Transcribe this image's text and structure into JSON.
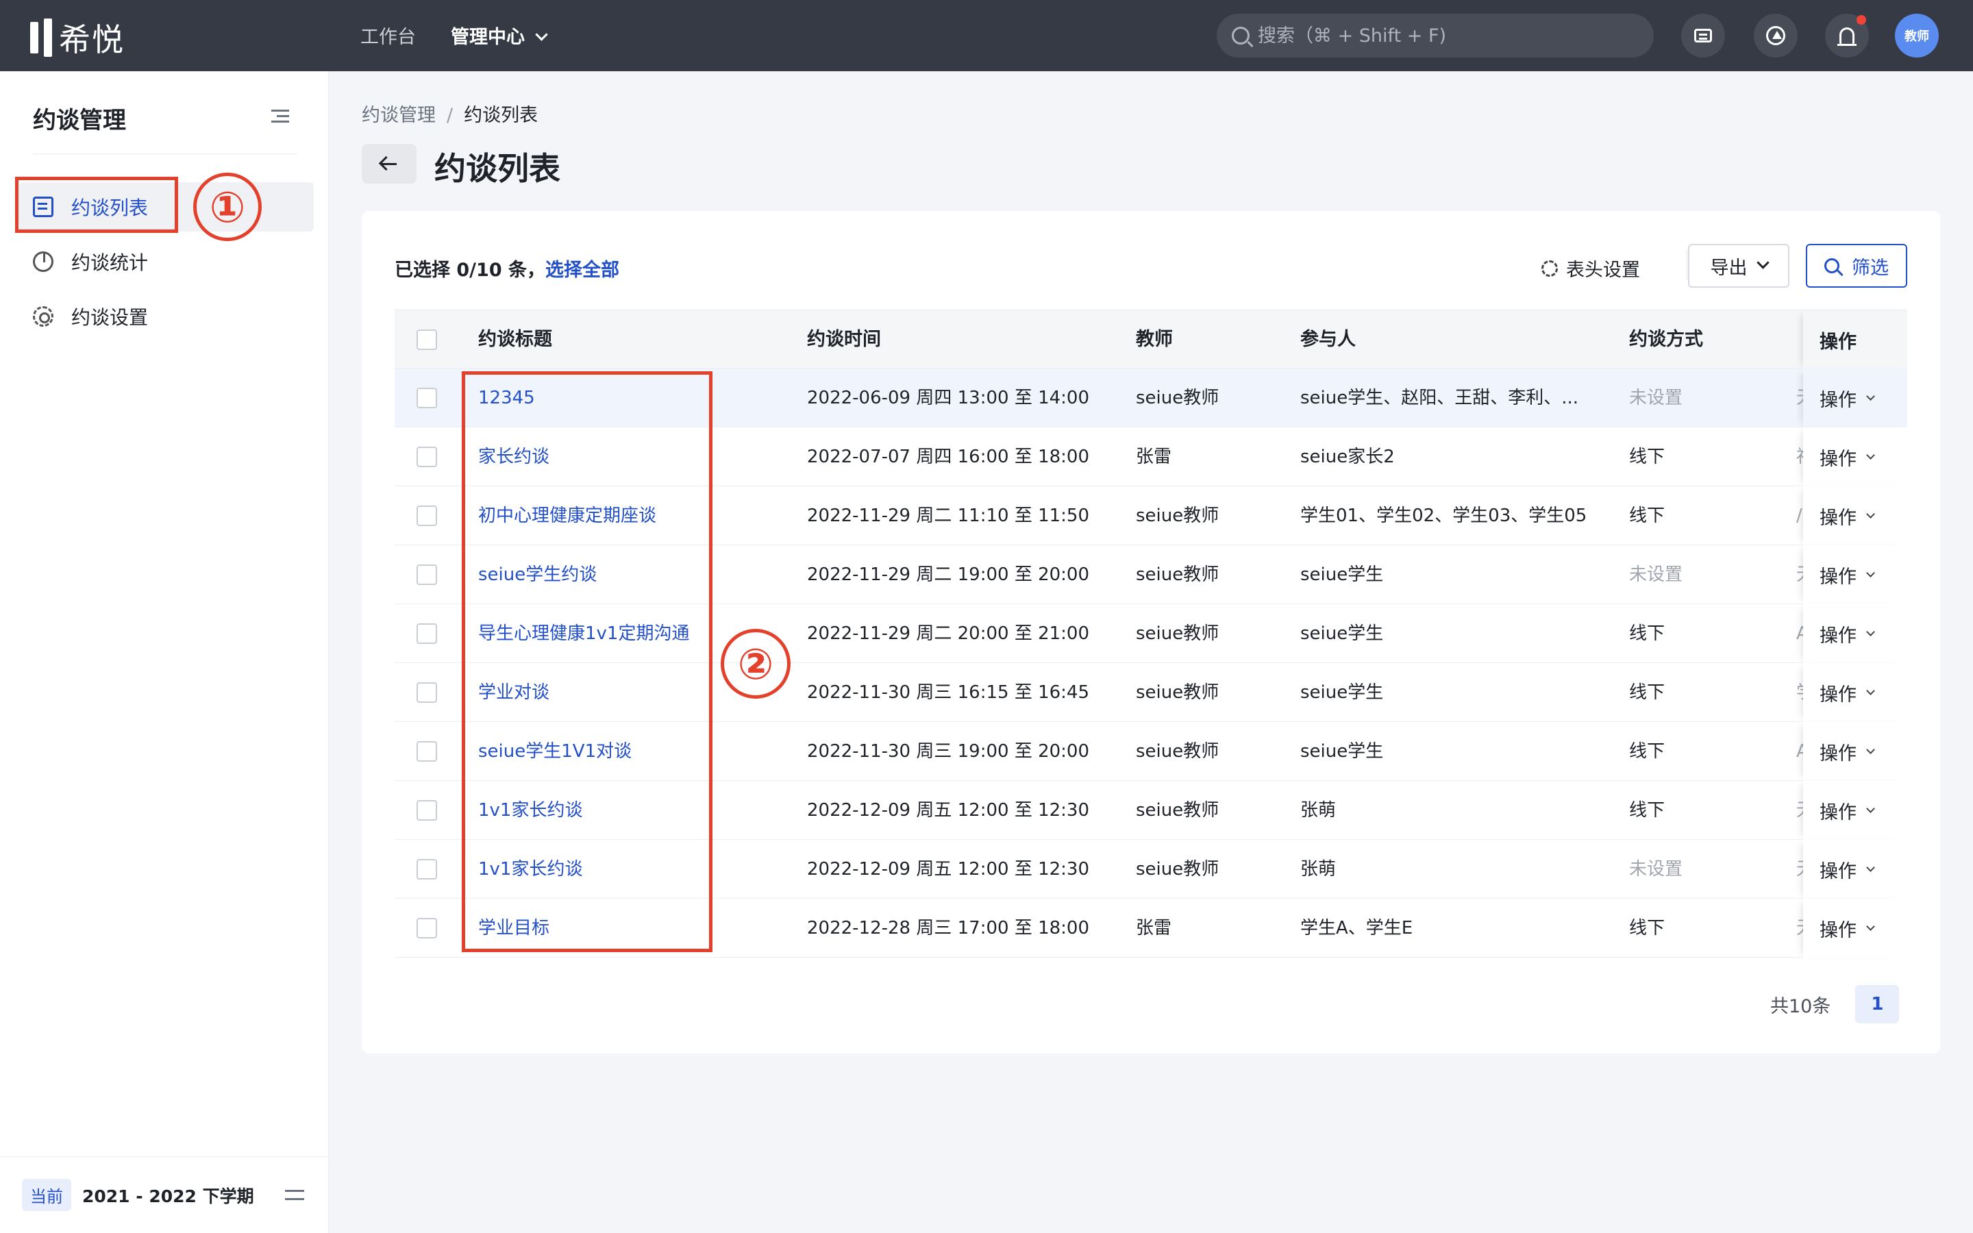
{
  "topbar": {
    "logo_text": "希悦",
    "nav": [
      {
        "label": "工作台"
      },
      {
        "label": "管理中心"
      }
    ],
    "search_placeholder": "搜索（⌘ + Shift + F)",
    "icons": [
      "message-icon",
      "app-store-icon",
      "bell-icon"
    ],
    "avatar_label": "教师"
  },
  "sidebar": {
    "title": "约谈管理",
    "items": [
      {
        "label": "约谈列表",
        "icon": "list-icon",
        "active": true
      },
      {
        "label": "约谈统计",
        "icon": "pie-chart-icon",
        "active": false
      },
      {
        "label": "约谈设置",
        "icon": "gear-icon",
        "active": false
      }
    ],
    "footer": {
      "badge": "当前",
      "term": "2021 - 2022 下学期"
    }
  },
  "annotations": {
    "mark1": "①",
    "mark2": "②"
  },
  "breadcrumb": {
    "parent": "约谈管理",
    "separator": "/",
    "current": "约谈列表"
  },
  "page": {
    "title": "约谈列表"
  },
  "toolbar": {
    "selection_prefix": "已选择 0/10 条，",
    "select_all": "选择全部",
    "header_settings": "表头设置",
    "export": "导出",
    "filter": "筛选"
  },
  "table": {
    "columns": [
      "约谈标题",
      "约谈时间",
      "教师",
      "参与人",
      "约谈方式",
      "操作"
    ],
    "rows": [
      {
        "title": "12345",
        "time": "2022-06-09 周四 13:00 至 14:00",
        "teacher": "seiue教师",
        "participants": "seiue学生、赵阳、王甜、李利、...",
        "mode": "未设置",
        "mode_muted": true,
        "clip": "无"
      },
      {
        "title": "家长约谈",
        "time": "2022-07-07 周四 16:00 至 18:00",
        "teacher": "张雷",
        "participants": "seiue家长2",
        "mode": "线下",
        "mode_muted": false,
        "clip": "福"
      },
      {
        "title": "初中心理健康定期座谈",
        "time": "2022-11-29 周二 11:10 至 11:50",
        "teacher": "seiue教师",
        "participants": "学生01、学生02、学生03、学生05",
        "mode": "线下",
        "mode_muted": false,
        "clip": "/"
      },
      {
        "title": "seiue学生约谈",
        "time": "2022-11-29 周二 19:00 至 20:00",
        "teacher": "seiue教师",
        "participants": "seiue学生",
        "mode": "未设置",
        "mode_muted": true,
        "clip": "无"
      },
      {
        "title": "导生心理健康1v1定期沟通",
        "time": "2022-11-29 周二 20:00 至 21:00",
        "teacher": "seiue教师",
        "participants": "seiue学生",
        "mode": "线下",
        "mode_muted": false,
        "clip": "A"
      },
      {
        "title": "学业对谈",
        "time": "2022-11-30 周三 16:15 至 16:45",
        "teacher": "seiue教师",
        "participants": "seiue学生",
        "mode": "线下",
        "mode_muted": false,
        "clip": "学"
      },
      {
        "title": "seiue学生1V1对谈",
        "time": "2022-11-30 周三 19:00 至 20:00",
        "teacher": "seiue教师",
        "participants": "seiue学生",
        "mode": "线下",
        "mode_muted": false,
        "clip": "A"
      },
      {
        "title": "1v1家长约谈",
        "time": "2022-12-09 周五 12:00 至 12:30",
        "teacher": "seiue教师",
        "participants": "张萌",
        "mode": "线下",
        "mode_muted": false,
        "clip": "无"
      },
      {
        "title": "1v1家长约谈",
        "time": "2022-12-09 周五 12:00 至 12:30",
        "teacher": "seiue教师",
        "participants": "张萌",
        "mode": "未设置",
        "mode_muted": true,
        "clip": "无"
      },
      {
        "title": "学业目标",
        "time": "2022-12-28 周三 17:00 至 18:00",
        "teacher": "张雷",
        "participants": "学生A、学生E",
        "mode": "线下",
        "mode_muted": false,
        "clip": "无"
      }
    ],
    "row_action": "操作"
  },
  "pagination": {
    "total": "共10条",
    "current_page": "1"
  },
  "colors": {
    "topbar_bg": "#353a45",
    "accent": "#2350c8",
    "annotation": "#e3412b"
  }
}
